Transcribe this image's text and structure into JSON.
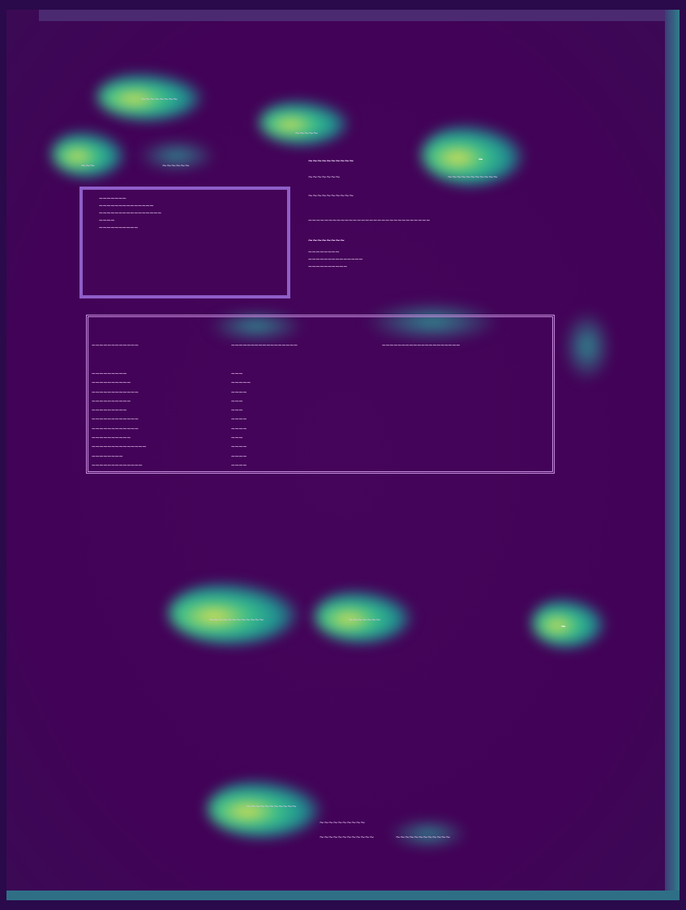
{
  "form": {
    "title_top": "~~~~~~~~",
    "subtitle": "~~~~~",
    "field_left_a": "~~~",
    "field_left_b": "~~~~~~",
    "field_mid_label": "~~~~~~~~~~",
    "field_mid_value": "~~~~~~~",
    "field_mid_value2": "~~~~~~~~~~",
    "field_mid_long": "~~~~~~~~~~~~~~~~~~~~~~~~~~~~~~",
    "field_right_mark": "~",
    "field_right_value": "~~~~~~~~~~~"
  },
  "address": {
    "lines": [
      "~~~~~~~",
      "~~~~~~~~~~~~~~",
      "~~~~~~~~~~~~~~~~",
      "~~~~",
      "~~~~~~~~~~"
    ]
  },
  "contact": {
    "heading": "~~~~~~~~",
    "lines": [
      "~~~~~~~~",
      "~~~~~~~~~~~~~~",
      "~~~~~~~~~~"
    ]
  },
  "table": {
    "headers": [
      "~~~~~~~~~~~~",
      "~~~~~~~~~~~~~~~~~",
      "~~~~~~~~~~~~~~~~~~~~"
    ],
    "col1": [
      "~~~~~~~~~",
      "~~~~~~~~~~",
      "~~~~~~~~~~~~",
      "~~~~~~~~~~",
      "~~~~~~~~~",
      "~~~~~~~~~~~~",
      "~~~~~~~~~~~~",
      "~~~~~~~~~~",
      "~~~~~~~~~~~~~~",
      "~~~~~~~~",
      "~~~~~~~~~~~~~"
    ],
    "col2": [
      "~~~",
      "~~~~~",
      "~~~~",
      "~~~",
      "~~~",
      "~~~~",
      "~~~~",
      "~~~",
      "~~~~",
      "~~~~",
      "~~~~"
    ]
  },
  "signatures": {
    "left": "~~~~~~~~~~~~",
    "mid": "~~~~~~~",
    "right": "~"
  },
  "footer": {
    "stamp": "~~~~~~~~~~~",
    "line1": "~~~~~~~~~~",
    "line2a": "~~~~~~~~~~~~",
    "line2b": "~~~~~~~~~~~~"
  },
  "colors": {
    "background": "#420257",
    "highlight": "#f0e44a",
    "accent": "#2f8f92",
    "box_border": "#8f5fc8"
  }
}
